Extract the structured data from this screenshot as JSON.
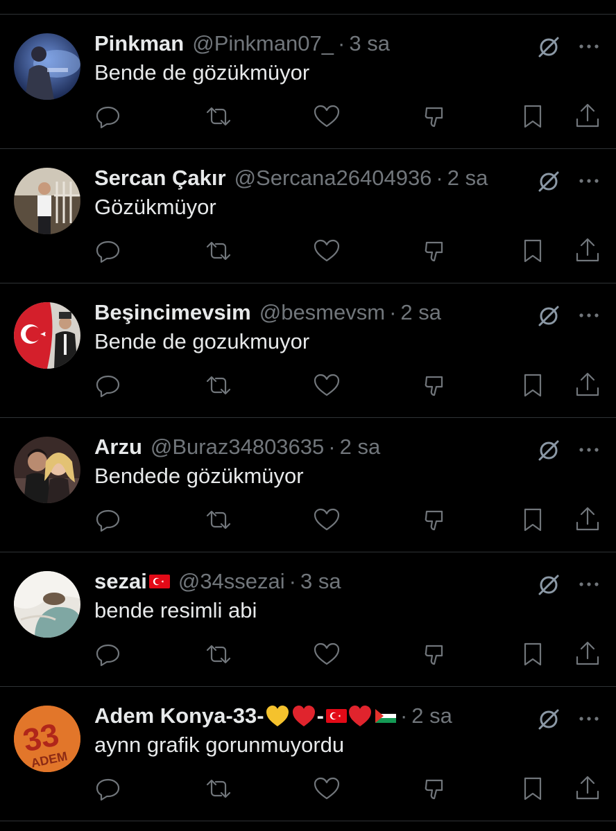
{
  "tweets": [
    {
      "name": "Pinkman",
      "handle": "@Pinkman07_",
      "separator": "·",
      "time": "3 sa",
      "text": "Bende de gözükmüyor",
      "avatar": "avatar-pinkman"
    },
    {
      "name": "Sercan Çakır",
      "handle": "@Sercana26404936",
      "separator": "·",
      "time": "2 sa",
      "text": "Gözükmüyor",
      "avatar": "avatar-sercan"
    },
    {
      "name": "Beşincimevsim",
      "handle": "@besmevsm",
      "separator": "·",
      "time": "2 sa",
      "text": "Bende de gozukmuyor",
      "avatar": "avatar-flag-ataturk"
    },
    {
      "name": "Arzu",
      "handle": "@Buraz34803635",
      "separator": "·",
      "time": "2 sa",
      "text": "Bendede gözükmüyor",
      "avatar": "avatar-couple"
    },
    {
      "name": "sezai",
      "name_suffix_icons": [
        "turkey-flag"
      ],
      "handle": "@34ssezai",
      "separator": "·",
      "time": "3 sa",
      "text": "bende resimli abi",
      "avatar": "avatar-cat"
    },
    {
      "name": "Adem Konya-33-",
      "name_suffix_icons": [
        "yellow-heart",
        "red-heart",
        "-",
        "turkey-flag",
        "red-heart",
        "palestine-flag"
      ],
      "separator": "·",
      "time": "2 sa",
      "text": "aynn grafik gorunmuyordu",
      "avatar": "avatar-33-jersey"
    }
  ],
  "adem_dash": "-",
  "icons": {
    "grok": "grok-slash-icon",
    "more": "more-dots-icon",
    "actions": [
      "reply-icon",
      "retweet-icon",
      "like-icon",
      "dislike-icon",
      "bookmark-icon",
      "share-icon"
    ]
  },
  "colors": {
    "background": "#000000",
    "text_primary": "#e7e9ea",
    "text_secondary": "#71767b",
    "divider": "#2f3336",
    "icon": "#71767b",
    "icon_grok": "#8b98a5"
  }
}
